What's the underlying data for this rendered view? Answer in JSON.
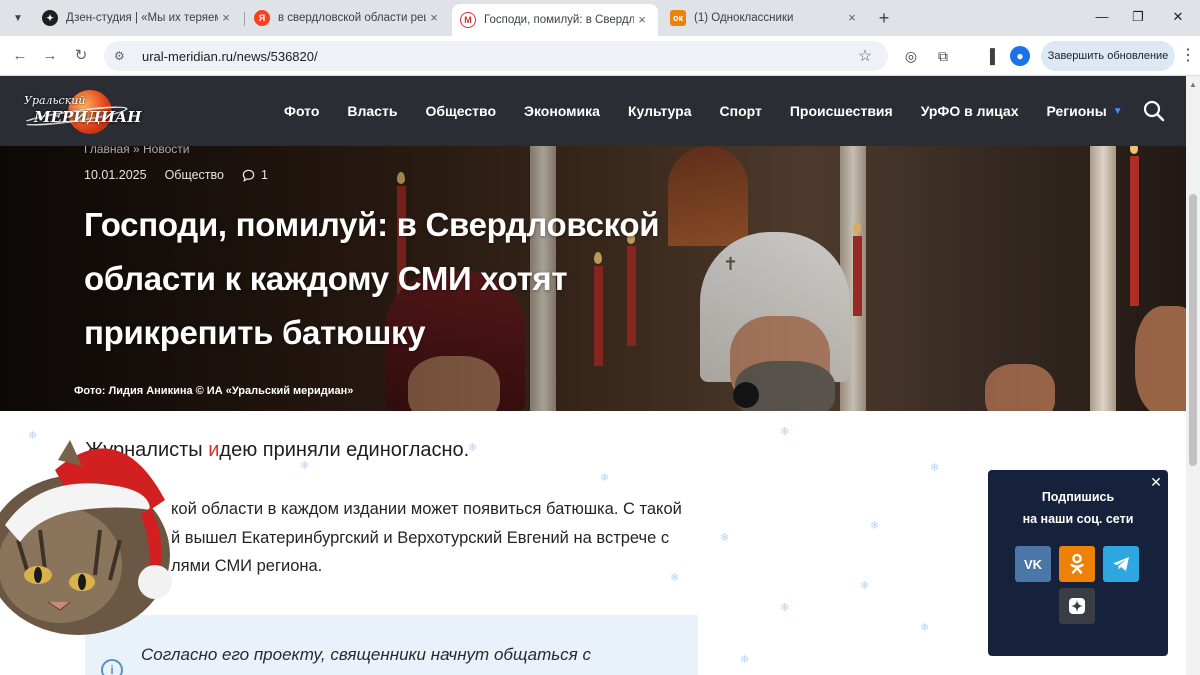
{
  "browser": {
    "tabs": [
      {
        "title": "Дзен-студия | «Мы их теряем»",
        "favicon": "dzen-icon",
        "active": false
      },
      {
        "title": "в свердловской области реши",
        "favicon": "yandex-icon",
        "active": false
      },
      {
        "title": "Господи, помилуй: в Свердлов",
        "favicon": "meridian-icon",
        "active": true
      },
      {
        "title": "(1) Одноклассники",
        "favicon": "ok-icon",
        "active": false
      }
    ],
    "url": "ural-meridian.ru/news/536820/",
    "update_button": "Завершить обновление",
    "colors": {
      "tabstrip": "#dfe3e8",
      "yandex": "#fc3f1d",
      "ok": "#ee8208"
    }
  },
  "site": {
    "logo": {
      "line1": "Уральский",
      "line2": "МЕРИДИАН"
    },
    "nav": [
      "Фото",
      "Власть",
      "Общество",
      "Экономика",
      "Культура",
      "Спорт",
      "Происшествия",
      "УрФО в лицах",
      "Регионы"
    ],
    "header_color": "#2b2d35"
  },
  "article": {
    "breadcrumb": "Главная » Новости",
    "date": "10.01.2025",
    "category": "Общество",
    "comments": "1",
    "title": "Господи, помилуй: в Свердловской области к каждому СМИ хотят прикрепить батюшку",
    "photo_caption": "Фото: Лидия Аникина © ИА «Уральский меридиан»",
    "lead_prefix": "Журналисты ",
    "lead_strike": "и",
    "lead_suffix": "дею приняли единогласно.",
    "para_lines": [
      "кой области в каждом издании может появиться батюшка. С такой",
      "й вышел Екатеринбургский и Верхотурский Евгений на встрече с",
      "лями СМИ региона."
    ],
    "quote": "Согласно его проекту, священники начнут общаться с"
  },
  "social_popup": {
    "line1": "Подпишись",
    "line2": "на наши соц. сети",
    "buttons": [
      {
        "name": "vk",
        "label": "ВК",
        "color": "#4a76a8"
      },
      {
        "name": "ok",
        "label": "ОК",
        "color": "#ee8208"
      },
      {
        "name": "telegram",
        "label": "TG",
        "color": "#2ea6e0"
      },
      {
        "name": "dzen",
        "label": "Дзен",
        "color": "#3a3d44"
      }
    ]
  }
}
